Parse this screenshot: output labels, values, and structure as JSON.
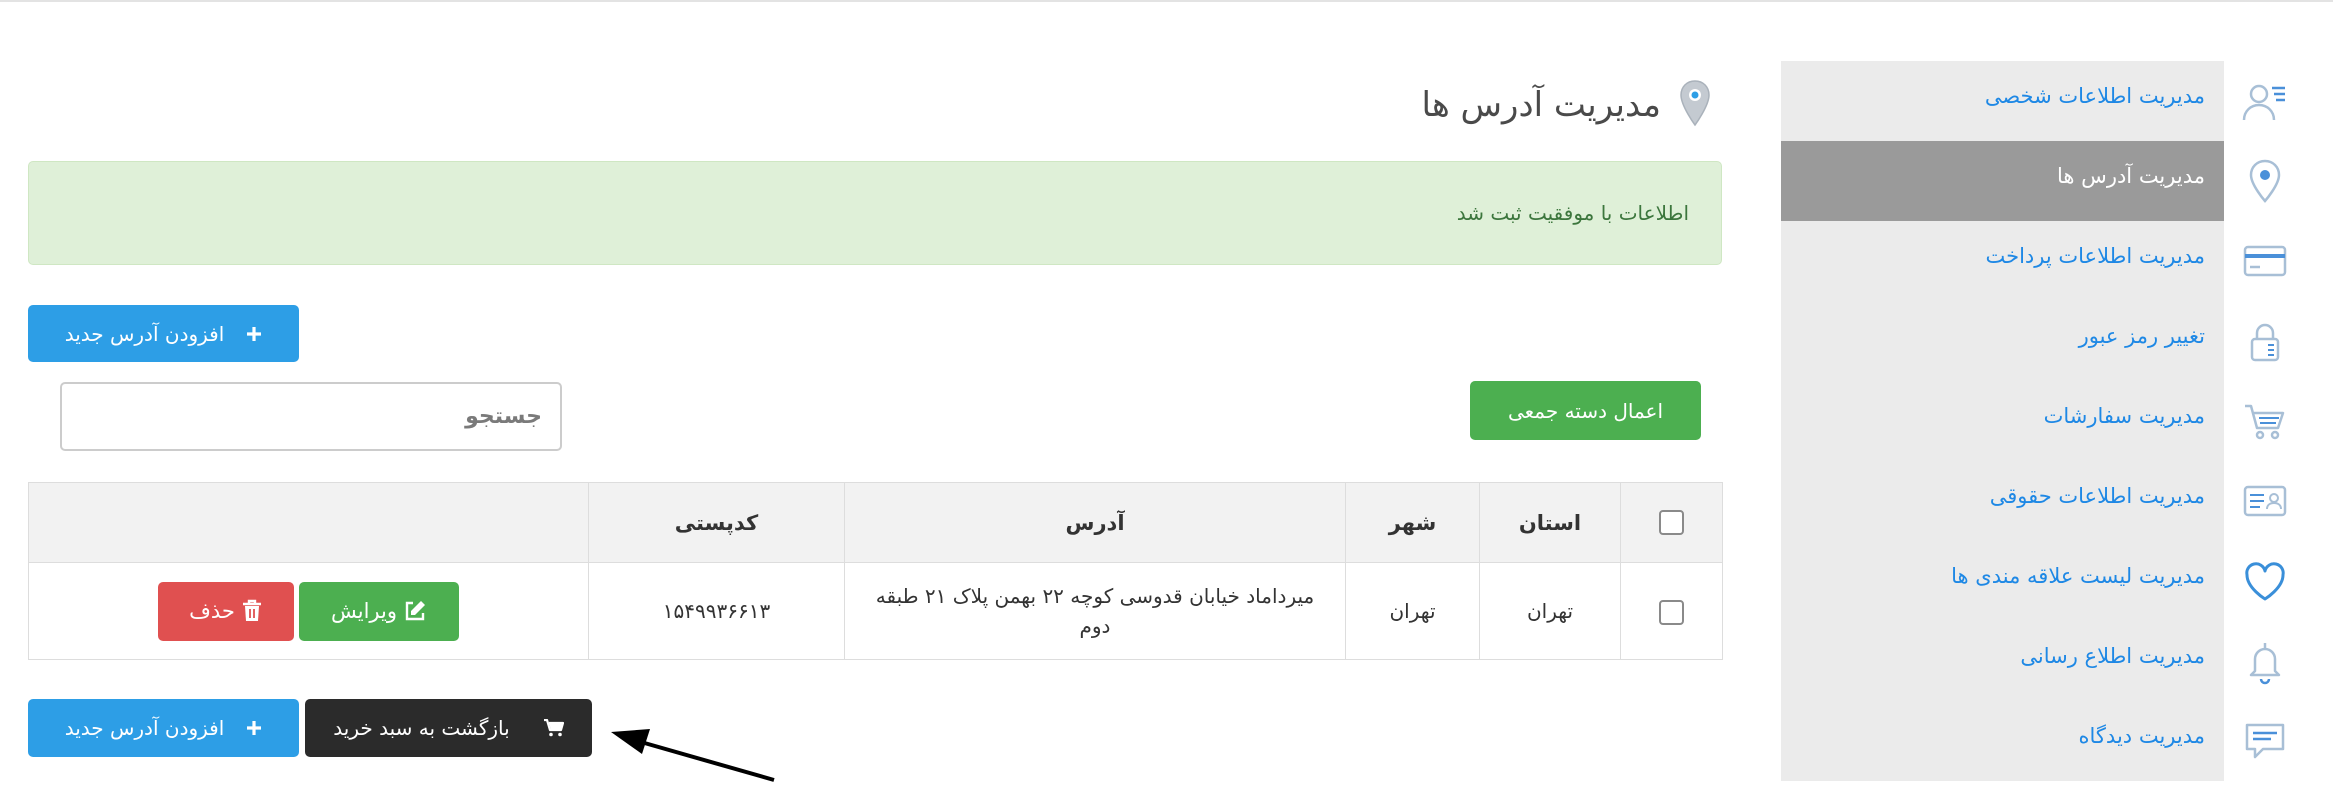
{
  "page": {
    "title": "مدیریت آدرس ها",
    "title_icon": "location-pin-icon"
  },
  "alert": {
    "type": "success",
    "text": "اطلاعات با موفقیت ثبت شد"
  },
  "toolbar": {
    "add_label": "افزودن آدرس جدید",
    "add_icon": "plus-icon",
    "bulk_label": "اعمال دسته جمعی",
    "search_placeholder": "جستجو",
    "search_value": ""
  },
  "table": {
    "headers": {
      "province": "استان",
      "city": "شهر",
      "address": "آدرس",
      "postal": "کدپستی",
      "actions": ""
    },
    "select_all_checked": false,
    "rows": [
      {
        "checked": false,
        "province": "تهران",
        "city": "تهران",
        "address": "میرداماد خیابان قدوسی کوچه ۲۲ بهمن پلاک ۲۱ طبقه دوم",
        "postal": "۱۵۴۹۹۳۶۶۱۳",
        "edit_label": "ویرایش",
        "edit_icon": "edit-icon",
        "delete_label": "حذف",
        "delete_icon": "trash-icon"
      }
    ]
  },
  "footer": {
    "back_label": "بازگشت به سبد خرید",
    "back_icon": "cart-icon",
    "add_label": "افزودن آدرس جدید",
    "add_icon": "plus-icon"
  },
  "sidebar": {
    "items": [
      {
        "label": "مدیریت اطلاعات شخصی",
        "icon": "user-list-icon",
        "active": false
      },
      {
        "label": "مدیریت آدرس ها",
        "icon": "location-pin-icon",
        "active": true
      },
      {
        "label": "مدیریت اطلاعات پرداخت",
        "icon": "credit-card-icon",
        "active": false
      },
      {
        "label": "تغییر رمز عبور",
        "icon": "lock-icon",
        "active": false
      },
      {
        "label": "مدیریت سفارشات",
        "icon": "cart-icon",
        "active": false
      },
      {
        "label": "مدیریت اطلاعات حقوقی",
        "icon": "id-card-icon",
        "active": false
      },
      {
        "label": "مدیریت لیست علاقه مندی ها",
        "icon": "heart-icon",
        "active": false
      },
      {
        "label": "مدیریت اطلاع رسانی",
        "icon": "bell-icon",
        "active": false
      },
      {
        "label": "مدیریت دیدگاه",
        "icon": "comment-icon",
        "active": false
      }
    ]
  },
  "colors": {
    "primary": "#2d9ee6",
    "success": "#4caf50",
    "danger": "#e05050",
    "dark": "#2b2b2b",
    "link": "#1e88e5",
    "sidebar_bg": "#ebebeb",
    "sidebar_active": "#9a9a9a",
    "alert_bg": "#dff0d8",
    "alert_text": "#3c763d"
  }
}
